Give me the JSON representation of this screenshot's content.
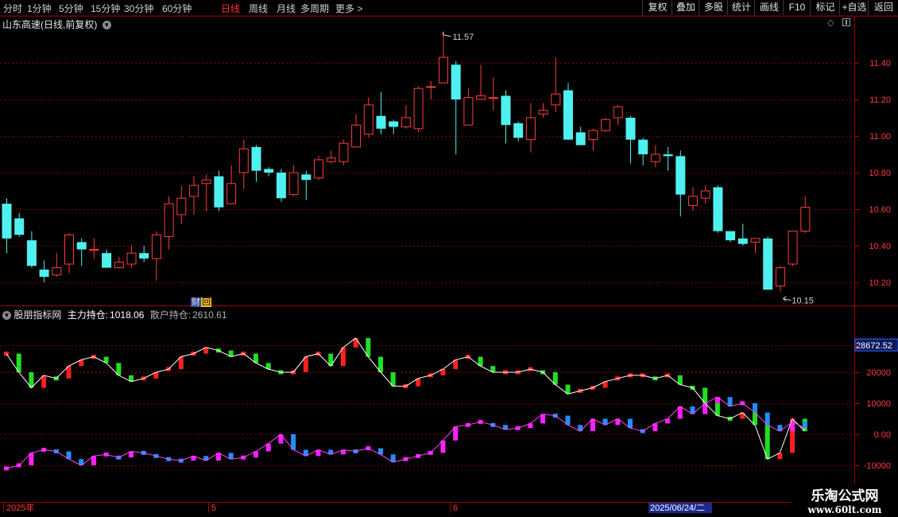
{
  "toolbar": {
    "periods": [
      "分时",
      "1分钟",
      "5分钟",
      "15分钟",
      "30分钟",
      "60分钟",
      "日线",
      "周线",
      "月线",
      "多周期",
      "更多 >"
    ],
    "active": "日线",
    "right_buttons": [
      "复权",
      "叠加",
      "多股",
      "统计",
      "画线",
      "F10",
      "标记",
      "+自选",
      "返回"
    ]
  },
  "price_panel": {
    "title": "山东高速(日线,前复权)",
    "high_marker": "11.57",
    "low_marker": "10.15",
    "finance_tag": "财",
    "review_tag": "回"
  },
  "indicator_panel": {
    "name": "股朋指标网",
    "main_label": "主力持仓:",
    "main_value": "1018.06",
    "retail_label": "散户持仓:",
    "retail_value": "2610.61",
    "top_value": "28672.52"
  },
  "x_axis": {
    "labels": [
      "2025年",
      "5",
      "6"
    ],
    "cursor_date": "2025/06/24/二"
  },
  "watermark": {
    "line1": "乐淘公式网",
    "line2": "www.60lt.com"
  },
  "colors": {
    "up": "#ff3c3c",
    "down": "#4ff0f0",
    "grid": "#7a0000",
    "main_line": "#ffffff",
    "main_up": "#ff2020",
    "main_down": "#20e020",
    "retail_line": "#ff40ff",
    "retail_up": "#ff20ff",
    "retail_down": "#2090ff"
  },
  "chart_data": [
    {
      "type": "candlestick",
      "title": "山东高速(日线,前复权)",
      "y_ticks": [
        10.2,
        10.4,
        10.6,
        10.8,
        11.0,
        11.2,
        11.4
      ],
      "y_range": [
        10.12,
        11.6
      ],
      "candles": [
        [
          10.63,
          10.44,
          10.66,
          10.36
        ],
        [
          10.55,
          10.46,
          10.58,
          10.45
        ],
        [
          10.43,
          10.29,
          10.48,
          10.28
        ],
        [
          10.27,
          10.23,
          10.32,
          10.2
        ],
        [
          10.24,
          10.28,
          10.36,
          10.23
        ],
        [
          10.3,
          10.46,
          10.47,
          10.25
        ],
        [
          10.42,
          10.38,
          10.44,
          10.29
        ],
        [
          10.38,
          10.38,
          10.44,
          10.33
        ],
        [
          10.36,
          10.28,
          10.38,
          10.28
        ],
        [
          10.28,
          10.31,
          10.34,
          10.28
        ],
        [
          10.3,
          10.36,
          10.4,
          10.28
        ],
        [
          10.36,
          10.33,
          10.4,
          10.31
        ],
        [
          10.33,
          10.46,
          10.48,
          10.21
        ],
        [
          10.45,
          10.63,
          10.67,
          10.38
        ],
        [
          10.57,
          10.66,
          10.73,
          10.52
        ],
        [
          10.67,
          10.73,
          10.78,
          10.57
        ],
        [
          10.74,
          10.76,
          10.79,
          10.59
        ],
        [
          10.78,
          10.61,
          10.81,
          10.59
        ],
        [
          10.63,
          10.74,
          10.84,
          10.65
        ],
        [
          10.8,
          10.93,
          10.98,
          10.71
        ],
        [
          10.94,
          10.81,
          10.95,
          10.75
        ],
        [
          10.82,
          10.8,
          10.83,
          10.78
        ],
        [
          10.8,
          10.66,
          10.82,
          10.64
        ],
        [
          10.68,
          10.8,
          10.84,
          10.67
        ],
        [
          10.79,
          10.76,
          10.81,
          10.65
        ],
        [
          10.77,
          10.87,
          10.89,
          10.76
        ],
        [
          10.86,
          10.88,
          10.92,
          10.85
        ],
        [
          10.86,
          10.96,
          10.98,
          10.84
        ],
        [
          10.94,
          11.06,
          11.12,
          10.94
        ],
        [
          11.01,
          11.17,
          11.21,
          10.99
        ],
        [
          11.11,
          11.04,
          11.24,
          11.01
        ],
        [
          11.08,
          11.05,
          11.09,
          11.01
        ],
        [
          11.05,
          11.1,
          11.17,
          11.04
        ],
        [
          11.04,
          11.26,
          11.27,
          11.02
        ],
        [
          11.27,
          11.27,
          11.3,
          11.2
        ],
        [
          11.29,
          11.43,
          11.57,
          11.29
        ],
        [
          11.39,
          11.2,
          11.41,
          10.9
        ],
        [
          11.06,
          11.21,
          11.26,
          11.06
        ],
        [
          11.2,
          11.22,
          11.39,
          11.2
        ],
        [
          11.21,
          11.21,
          11.32,
          11.14
        ],
        [
          11.22,
          11.06,
          11.25,
          10.96
        ],
        [
          11.07,
          10.99,
          11.08,
          10.97
        ],
        [
          10.98,
          11.1,
          11.18,
          10.91
        ],
        [
          11.12,
          11.14,
          11.18,
          11.1
        ],
        [
          11.17,
          11.23,
          11.43,
          11.13
        ],
        [
          11.25,
          10.98,
          11.29,
          10.98
        ],
        [
          11.02,
          10.95,
          11.05,
          10.95
        ],
        [
          10.98,
          11.03,
          11.04,
          10.92
        ],
        [
          11.03,
          11.09,
          11.1,
          11.02
        ],
        [
          11.1,
          11.16,
          11.17,
          11.06
        ],
        [
          11.1,
          10.98,
          11.11,
          10.85
        ],
        [
          10.98,
          10.9,
          10.99,
          10.84
        ],
        [
          10.86,
          10.9,
          10.95,
          10.83
        ],
        [
          10.9,
          10.89,
          10.94,
          10.81
        ],
        [
          10.89,
          10.68,
          10.92,
          10.56
        ],
        [
          10.62,
          10.67,
          10.72,
          10.59
        ],
        [
          10.66,
          10.7,
          10.73,
          10.63
        ],
        [
          10.72,
          10.48,
          10.73,
          10.47
        ],
        [
          10.48,
          10.43,
          10.48,
          10.42
        ],
        [
          10.44,
          10.41,
          10.52,
          10.4
        ],
        [
          10.42,
          10.44,
          10.44,
          10.36
        ],
        [
          10.44,
          10.16,
          10.45,
          10.16
        ],
        [
          10.18,
          10.28,
          10.29,
          10.15
        ],
        [
          10.3,
          10.48,
          10.48,
          10.29
        ],
        [
          10.48,
          10.61,
          10.67,
          10.47
        ]
      ]
    },
    {
      "type": "line",
      "title": "股朋指标网",
      "y_ticks": [
        -10000,
        0,
        10000,
        20000,
        28672.52
      ],
      "y_tick_labels": [
        "-10000",
        "0.00",
        "10000",
        "20000",
        "28672.52"
      ],
      "y_range": [
        -20500,
        35000
      ],
      "series": [
        {
          "name": "主力持仓",
          "values": [
            26000,
            20000,
            15000,
            19000,
            18000,
            22000,
            24000,
            25000,
            23000,
            19000,
            17000,
            18000,
            20000,
            21000,
            25000,
            26000,
            28000,
            27000,
            25000,
            26000,
            23000,
            21000,
            20000,
            20000,
            25000,
            26000,
            22000,
            28000,
            31000,
            25000,
            20000,
            15500,
            15500,
            18000,
            19000,
            21000,
            24000,
            25000,
            22000,
            20000,
            20000,
            20000,
            21000,
            20000,
            16000,
            13000,
            14000,
            15000,
            17000,
            18000,
            19000,
            19000,
            18000,
            19000,
            16000,
            15000,
            10000,
            6000,
            5000,
            7000,
            3000,
            -8000,
            -6000,
            5000,
            1000
          ]
        },
        {
          "name": "散户持仓",
          "values": [
            -11000,
            -10000,
            -6000,
            -5000,
            -5500,
            -8000,
            -10000,
            -7000,
            -6500,
            -7500,
            -5500,
            -6000,
            -7000,
            -8000,
            -8500,
            -7000,
            -8500,
            -6000,
            -8000,
            -7500,
            -5500,
            -3000,
            0,
            -5000,
            -7000,
            -5000,
            -6500,
            -5000,
            -5500,
            -4500,
            -6500,
            -9000,
            -8000,
            -7000,
            -6000,
            -2000,
            2500,
            3000,
            4000,
            3000,
            1500,
            2000,
            3500,
            6500,
            6000,
            3000,
            1000,
            5000,
            3000,
            5000,
            2000,
            1000,
            3500,
            5000,
            9000,
            6500,
            10000,
            12000,
            9000,
            10000,
            7000,
            3000,
            1000,
            4000,
            2000
          ]
        }
      ]
    }
  ]
}
